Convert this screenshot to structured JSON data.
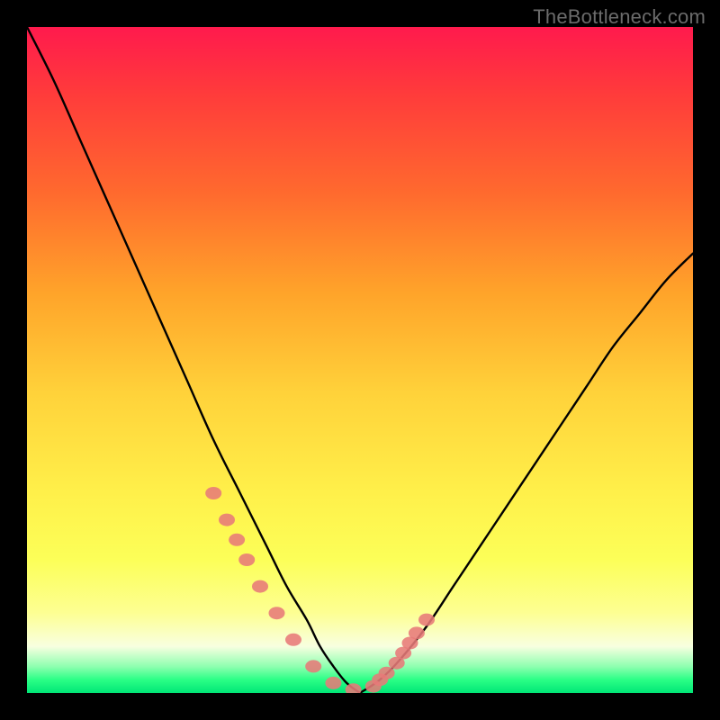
{
  "attribution": "TheBottleneck.com",
  "chart_data": {
    "type": "line",
    "title": "",
    "xlabel": "",
    "ylabel": "",
    "xlim": [
      0,
      100
    ],
    "ylim": [
      0,
      100
    ],
    "grid": false,
    "legend": false,
    "series": [
      {
        "name": "left-curve",
        "x": [
          0,
          4,
          8,
          12,
          16,
          20,
          24,
          28,
          32,
          36,
          39,
          42,
          44,
          46,
          48,
          50
        ],
        "y": [
          100,
          92,
          83,
          74,
          65,
          56,
          47,
          38,
          30,
          22,
          16,
          11,
          7,
          4,
          1.5,
          0
        ]
      },
      {
        "name": "right-curve",
        "x": [
          50,
          53,
          56,
          60,
          64,
          68,
          72,
          76,
          80,
          84,
          88,
          92,
          96,
          100
        ],
        "y": [
          0,
          2,
          5,
          10,
          16,
          22,
          28,
          34,
          40,
          46,
          52,
          57,
          62,
          66
        ]
      }
    ],
    "points": {
      "name": "markers",
      "x": [
        28,
        30,
        31.5,
        33,
        35,
        37.5,
        40,
        43,
        46,
        49,
        52,
        53,
        54,
        55.5,
        56.5,
        57.5,
        58.5,
        60
      ],
      "y": [
        30,
        26,
        23,
        20,
        16,
        12,
        8,
        4,
        1.5,
        0.5,
        1,
        2,
        3,
        4.5,
        6,
        7.5,
        9,
        11
      ]
    },
    "gradient_stops": [
      {
        "pos": 0,
        "color": "#ff1a4d"
      },
      {
        "pos": 10,
        "color": "#ff3b3b"
      },
      {
        "pos": 25,
        "color": "#ff6a2e"
      },
      {
        "pos": 40,
        "color": "#ffa42a"
      },
      {
        "pos": 55,
        "color": "#ffd23a"
      },
      {
        "pos": 70,
        "color": "#fff04a"
      },
      {
        "pos": 80,
        "color": "#fcff58"
      },
      {
        "pos": 88,
        "color": "#fdff93"
      },
      {
        "pos": 93,
        "color": "#f8ffe0"
      },
      {
        "pos": 96,
        "color": "#8fffb0"
      },
      {
        "pos": 98,
        "color": "#2bff86"
      },
      {
        "pos": 100,
        "color": "#00e676"
      }
    ]
  }
}
